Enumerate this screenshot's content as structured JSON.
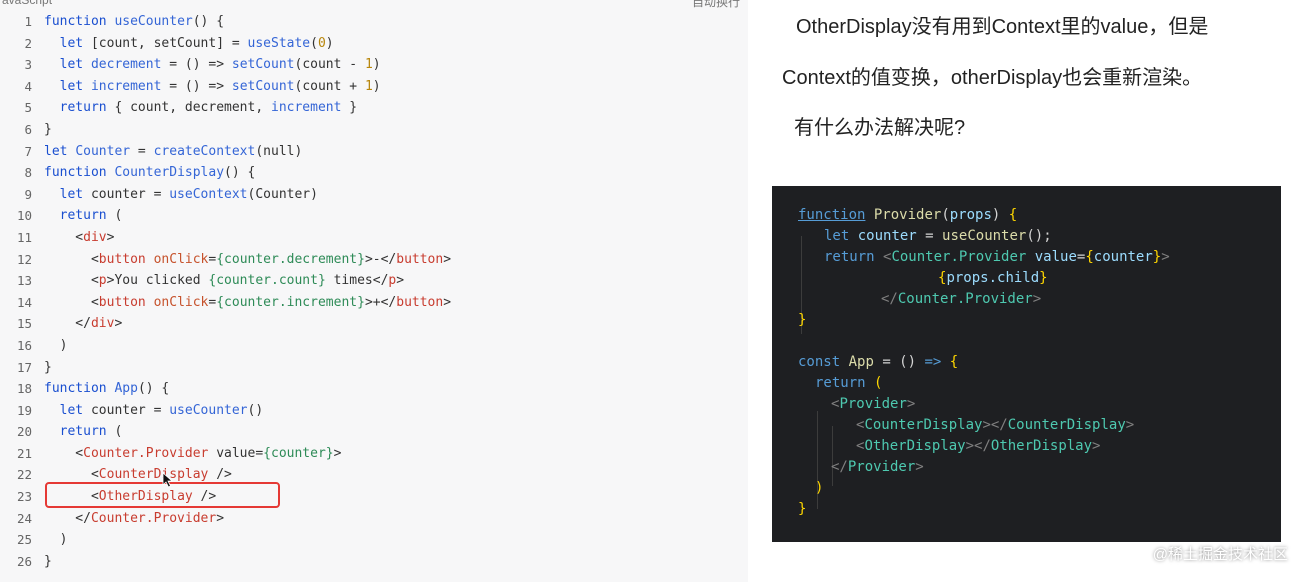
{
  "editor": {
    "language_label": "avaScript",
    "header_right": "自动换行",
    "lines": [
      {
        "n": "1",
        "text": "function useCounter() {"
      },
      {
        "n": "2",
        "text": "  let [count, setCount] = useState(0)"
      },
      {
        "n": "3",
        "text": "  let decrement = () => setCount(count - 1)"
      },
      {
        "n": "4",
        "text": "  let increment = () => setCount(count + 1)"
      },
      {
        "n": "5",
        "text": "  return { count, decrement, increment }"
      },
      {
        "n": "6",
        "text": "}"
      },
      {
        "n": "7",
        "text": "let Counter = createContext(null)"
      },
      {
        "n": "8",
        "text": "function CounterDisplay() {"
      },
      {
        "n": "9",
        "text": "  let counter = useContext(Counter)"
      },
      {
        "n": "10",
        "text": "  return ("
      },
      {
        "n": "11",
        "text": "    <div>"
      },
      {
        "n": "12",
        "text": "      <button onClick={counter.decrement}>-</button>"
      },
      {
        "n": "13",
        "text": "      <p>You clicked {counter.count} times</p>"
      },
      {
        "n": "14",
        "text": "      <button onClick={counter.increment}>+</button>"
      },
      {
        "n": "15",
        "text": "    </div>"
      },
      {
        "n": "16",
        "text": "  )"
      },
      {
        "n": "17",
        "text": "}"
      },
      {
        "n": "18",
        "text": "function App() {"
      },
      {
        "n": "19",
        "text": "  let counter = useCounter()"
      },
      {
        "n": "20",
        "text": "  return ("
      },
      {
        "n": "21",
        "text": "    <Counter.Provider value={counter}>"
      },
      {
        "n": "22",
        "text": "      <CounterDisplay />"
      },
      {
        "n": "23",
        "text": "      <OtherDisplay />"
      },
      {
        "n": "24",
        "text": "    </Counter.Provider>"
      },
      {
        "n": "25",
        "text": "  )"
      },
      {
        "n": "26",
        "text": "}"
      }
    ]
  },
  "notes": {
    "line1": "OtherDisplay没有用到Context里的value，但是",
    "line2": "Context的值变换，otherDisplay也会重新渲染。",
    "line3": "有什么办法解决呢?"
  },
  "snippet": {
    "lines": [
      "function Provider(props) {",
      "  let counter = useCounter();",
      "  return <Counter.Provider value={counter}>",
      "            {props.child}",
      "         </Counter.Provider>",
      "}",
      "",
      "const App = () => {",
      "  return (",
      "    <Provider>",
      "      <CounterDisplay></CounterDisplay>",
      "      <OtherDisplay></OtherDisplay>",
      "    </Provider>",
      "  )",
      "}"
    ]
  },
  "watermark": "@稀土掘金技术社区",
  "colors": {
    "highlight_box": "#e53935",
    "editor_bg": "#f7f7f8",
    "dark_panel_bg": "#1e1f22"
  }
}
